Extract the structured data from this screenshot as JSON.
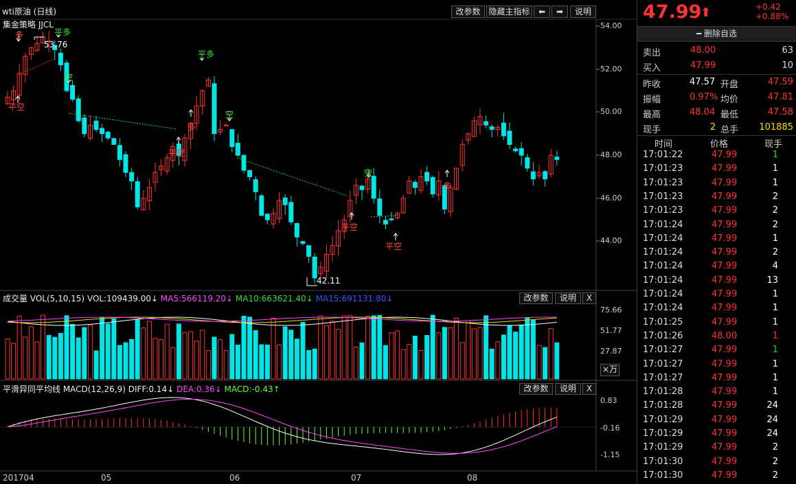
{
  "window": {
    "title": "wti原油 (日线)"
  },
  "toolbar": {
    "params_label": "改参数",
    "hide_indicator_label": "隐藏主指标",
    "prev_label": "⬅",
    "next_label": "➡",
    "help_label": "说明"
  },
  "main_chart": {
    "indicator_label": "集金策略 JJCL",
    "y_ticks": [
      "54.00",
      "52.00",
      "50.00",
      "48.00",
      "46.00",
      "44.00"
    ],
    "high_label": "53.76",
    "low_label": "42.11",
    "signals": [
      "多",
      "平多",
      "空",
      "平空",
      "平多",
      "多",
      "平空",
      "空",
      "平空",
      "空",
      "平空",
      "平空",
      "多"
    ],
    "x_labels": [
      "201704",
      "05",
      "06",
      "07",
      "08"
    ]
  },
  "volume_panel": {
    "title": "成交量 VOL(5,10,15)",
    "vol": "VOL:109439.00↓",
    "ma5": "MA5:566119.20↓",
    "ma10": "MA10:663621.40↓",
    "ma15": "MA15:691131.80↓",
    "y_ticks": [
      "75.66",
      "51.77",
      "27.87"
    ],
    "unit_label": "×万",
    "params_label": "改参数",
    "help_label": "说明",
    "close_label": "X"
  },
  "macd_panel": {
    "title": "平滑异同平均线 MACD(12,26,9)",
    "diff": "DIFF:0.14↓",
    "dea": "DEA:0.36↓",
    "macd": "MACD:-0.43↑",
    "y_ticks": [
      "0.83",
      "-0.16",
      "-1.15"
    ],
    "params_label": "改参数",
    "help_label": "说明",
    "close_label": "X"
  },
  "quote": {
    "price": "47.99",
    "change": "+0.42",
    "change_pct": "+0.88%",
    "remove_label": "删除自选",
    "sell_label": "卖出",
    "sell_price": "48.00",
    "sell_vol": "63",
    "buy_label": "买入",
    "buy_price": "47.99",
    "buy_vol": "10",
    "prev_close_label": "昨收",
    "prev_close": "47.57",
    "open_label": "开盘",
    "open": "47.59",
    "amp_label": "振幅",
    "amp": "0.97%",
    "avg_label": "均价",
    "avg": "47.81",
    "high_label": "最高",
    "high": "48.04",
    "low_label": "最低",
    "low": "47.58",
    "cur_vol_label": "现手",
    "cur_vol": "2",
    "total_vol_label": "总手",
    "total_vol": "101885"
  },
  "ticks": {
    "headers": [
      "时间",
      "价格",
      "现手"
    ],
    "rows": [
      [
        "17:01:22",
        "47.99",
        "1"
      ],
      [
        "17:01:23",
        "47.99",
        "1"
      ],
      [
        "17:01:23",
        "47.99",
        "1"
      ],
      [
        "17:01:23",
        "47.99",
        "2"
      ],
      [
        "17:01:23",
        "47.99",
        "2"
      ],
      [
        "17:01:24",
        "47.99",
        "2"
      ],
      [
        "17:01:24",
        "47.99",
        "1"
      ],
      [
        "17:01:24",
        "47.99",
        "2"
      ],
      [
        "17:01:24",
        "47.99",
        "4"
      ],
      [
        "17:01:24",
        "47.99",
        "13"
      ],
      [
        "17:01:24",
        "47.99",
        "1"
      ],
      [
        "17:01:24",
        "47.99",
        "1"
      ],
      [
        "17:01:25",
        "47.99",
        "1"
      ],
      [
        "17:01:26",
        "48.00",
        "1"
      ],
      [
        "17:01:27",
        "47.99",
        "1"
      ],
      [
        "17:01:27",
        "47.99",
        "1"
      ],
      [
        "17:01:27",
        "47.99",
        "1"
      ],
      [
        "17:01:28",
        "47.99",
        "1"
      ],
      [
        "17:01:28",
        "47.99",
        "24"
      ],
      [
        "17:01:29",
        "47.99",
        "24"
      ],
      [
        "17:01:29",
        "47.99",
        "24"
      ],
      [
        "17:01:29",
        "47.99",
        "2"
      ],
      [
        "17:01:30",
        "47.99",
        "2"
      ],
      [
        "17:01:30",
        "47.99",
        "2"
      ]
    ],
    "vol_colors": [
      "#22dd22",
      "#fff",
      "#fff",
      "#fff",
      "#fff",
      "#fff",
      "#fff",
      "#fff",
      "#fff",
      "#fff",
      "#fff",
      "#fff",
      "#fff",
      "#ff3333",
      "#22dd22",
      "#fff",
      "#fff",
      "#fff",
      "#fff",
      "#fff",
      "#fff",
      "#fff",
      "#fff",
      "#fff"
    ]
  },
  "colors": {
    "up": "#ff3333",
    "down": "#00e5e5",
    "ma5": "#ffffff",
    "ma10": "#e0e000",
    "ma15": "#ff44ff",
    "diff": "#ffffff",
    "dea": "#ff44ff",
    "macd_up": "#ff3333",
    "macd_down": "#66ff33"
  }
}
